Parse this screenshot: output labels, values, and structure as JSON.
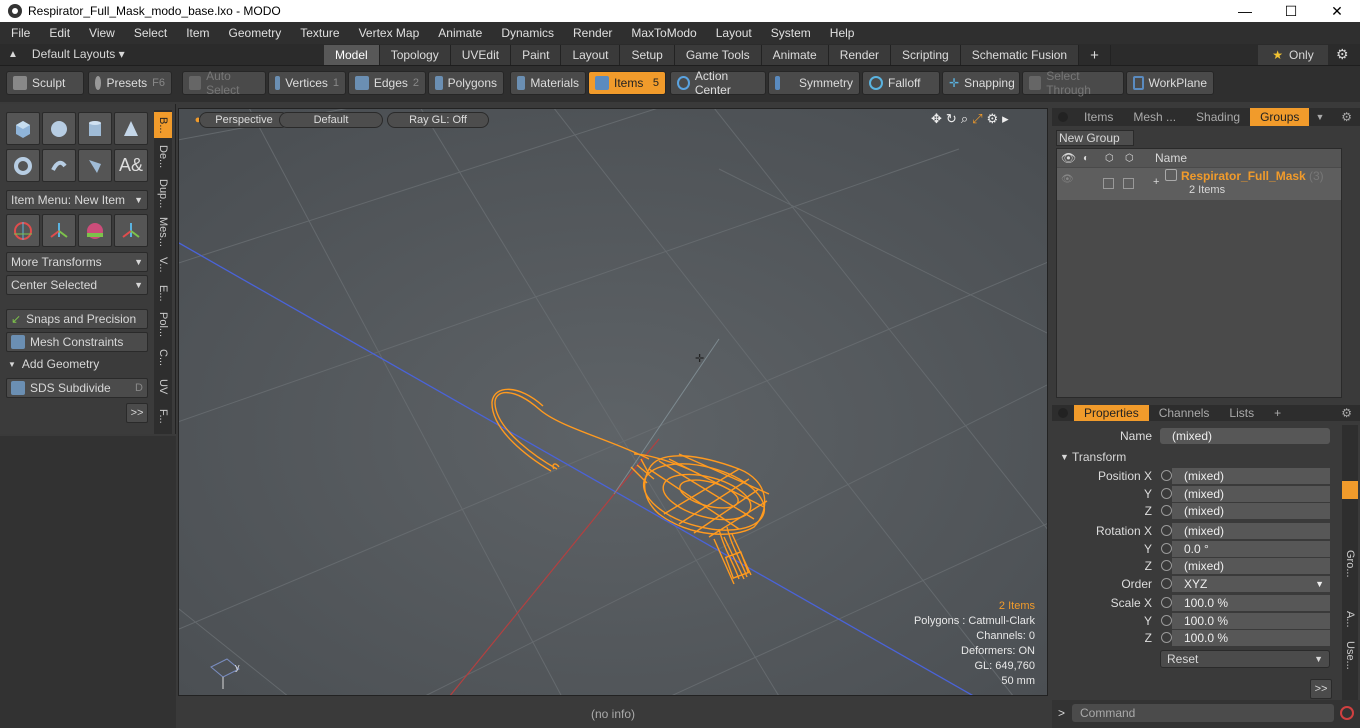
{
  "window": {
    "title": "Respirator_Full_Mask_modo_base.lxo - MODO",
    "minimize": "—",
    "maximize": "☐",
    "close": "✕"
  },
  "menu": [
    "File",
    "Edit",
    "View",
    "Select",
    "Item",
    "Geometry",
    "Texture",
    "Vertex Map",
    "Animate",
    "Dynamics",
    "Render",
    "MaxToModo",
    "Layout",
    "System",
    "Help"
  ],
  "layouts": {
    "label": "Default Layouts ▾"
  },
  "tabs": [
    "Model",
    "Topology",
    "UVEdit",
    "Paint",
    "Layout",
    "Setup",
    "Game Tools",
    "Animate",
    "Render",
    "Scripting",
    "Schematic Fusion",
    "+"
  ],
  "active_tab": "Model",
  "only": {
    "label": "Only",
    "star": "★"
  },
  "toolbar": {
    "sculpt": "Sculpt",
    "presets": "Presets",
    "presets_key": "F6",
    "auto_select": "Auto Select",
    "vertices": "Vertices",
    "vertices_num": "1",
    "edges": "Edges",
    "edges_num": "2",
    "polygons": "Polygons",
    "materials": "Materials",
    "items": "Items",
    "items_num": "5",
    "action_center": "Action Center",
    "symmetry": "Symmetry",
    "falloff": "Falloff",
    "snapping": "Snapping",
    "select_through": "Select Through",
    "workplane": "WorkPlane"
  },
  "left": {
    "item_menu": "Item Menu: New Item",
    "more_transforms": "More Transforms",
    "center_selected": "Center Selected",
    "snaps": "Snaps and Precision",
    "mesh_constraints": "Mesh Constraints",
    "add_geometry": "Add Geometry",
    "sds": "SDS Subdivide",
    "sds_key": "D",
    "more": ">>",
    "vtabs": [
      "B...",
      "De...",
      "Dup...",
      "Mes...",
      "V...",
      "E...",
      "Pol...",
      "C...",
      "UV",
      "F..."
    ]
  },
  "viewport": {
    "perspective": "Perspective",
    "default": "Default",
    "raygl": "Ray GL: Off",
    "info": {
      "items": "2 Items",
      "polygons": "Polygons : Catmull-Clark",
      "channels": "Channels: 0",
      "deformers": "Deformers: ON",
      "gl": "GL: 649,760",
      "size": "50 mm"
    }
  },
  "status": {
    "text": "(no info)"
  },
  "right": {
    "tabs": [
      "Items",
      "Mesh ...",
      "Shading",
      "Groups"
    ],
    "active_tab": "Groups",
    "new_group": "New Group",
    "col_name": "Name",
    "group_name": "Respirator_Full_Mask",
    "group_count": "(3)",
    "group_items": "2 Items",
    "prop_tabs": [
      "Properties",
      "Channels",
      "Lists",
      "+"
    ],
    "name_label": "Name",
    "name_value": "(mixed)",
    "transform": "Transform",
    "position": [
      {
        "label": "Position X",
        "value": "(mixed)"
      },
      {
        "label": "Y",
        "value": "(mixed)"
      },
      {
        "label": "Z",
        "value": "(mixed)"
      }
    ],
    "rotation": [
      {
        "label": "Rotation X",
        "value": "(mixed)"
      },
      {
        "label": "Y",
        "value": "0.0 °"
      },
      {
        "label": "Z",
        "value": "(mixed)"
      }
    ],
    "order_label": "Order",
    "order_value": "XYZ",
    "scale": [
      {
        "label": "Scale X",
        "value": "100.0 %"
      },
      {
        "label": "Y",
        "value": "100.0 %"
      },
      {
        "label": "Z",
        "value": "100.0 %"
      }
    ],
    "reset": "Reset",
    "more": ">>",
    "side_tabs": [
      "Gro...",
      "A...",
      "Use..."
    ]
  },
  "command": {
    "prompt": ">",
    "placeholder": "Command"
  },
  "colors": {
    "accent": "#f19b2b",
    "wire": "#ff9a1f"
  }
}
